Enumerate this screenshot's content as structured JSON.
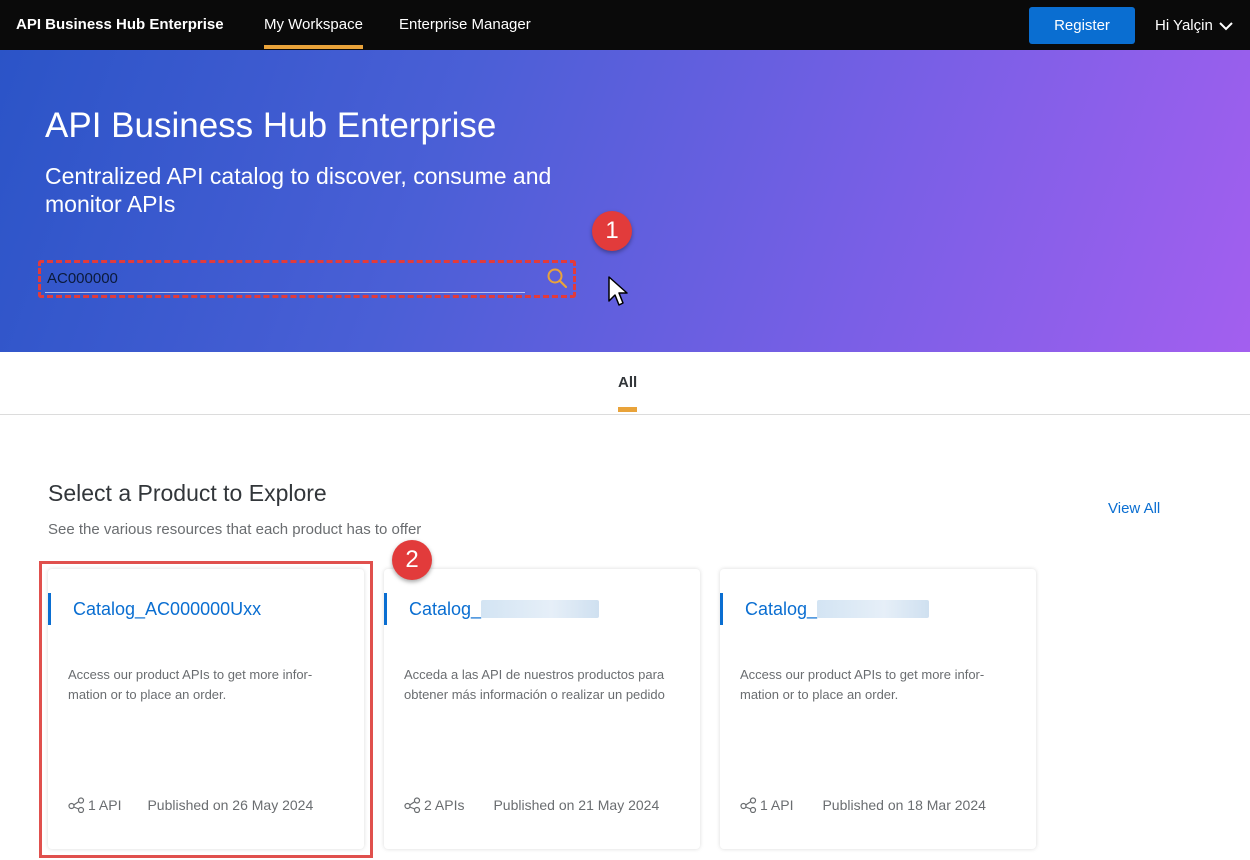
{
  "topbar": {
    "brand": "API Business Hub Enterprise",
    "tabs": [
      {
        "label": "My Workspace",
        "active": true
      },
      {
        "label": "Enterprise Manager",
        "active": false
      }
    ],
    "register_label": "Register",
    "user_greeting": "Hi Yalçin"
  },
  "hero": {
    "title": "API Business Hub Enterprise",
    "subtitle": "Centralized API catalog to discover, consume and monitor APIs",
    "search_value": "AC000000"
  },
  "annotations": {
    "badge_1": "1",
    "badge_2": "2"
  },
  "tabs": {
    "all_label": "All"
  },
  "section": {
    "title": "Select a Product to Explore",
    "subtitle": "See the various resources that each product has to offer",
    "view_all": "View All"
  },
  "cards": [
    {
      "title": "Catalog_AC000000Uxx",
      "redacted": false,
      "description": "Access our product APIs to get more infor-\nmation or to place an order.",
      "api_count": "1 API",
      "published": "Published on 26 May 2024"
    },
    {
      "title": "Catalog_",
      "redacted": true,
      "description": "Acceda a las API de nuestros productos para obtener más información o realizar un pedido",
      "api_count": "2 APIs",
      "published": "Published on 21 May 2024"
    },
    {
      "title": "Catalog_",
      "redacted": true,
      "description": "Access our product APIs to get more infor-\nmation or to place an order.",
      "api_count": "1 API",
      "published": "Published on 18 Mar 2024"
    }
  ],
  "colors": {
    "accent_blue": "#0a6ed1",
    "tab_indicator": "#e9a33a",
    "annotation_red": "#e23b3b"
  }
}
